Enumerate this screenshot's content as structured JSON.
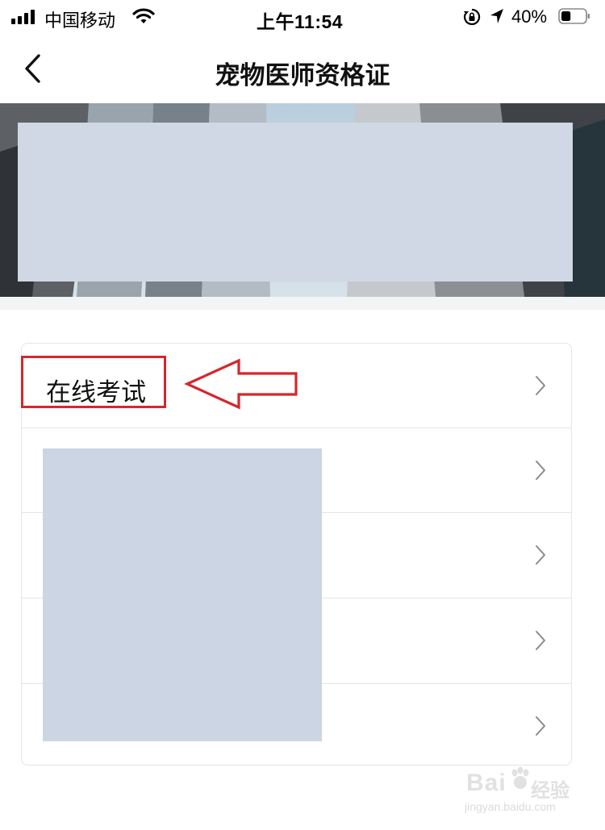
{
  "status_bar": {
    "carrier": "中国移动",
    "time": "上午11:54",
    "battery_percent": "40%",
    "battery_level": 0.4,
    "icons": [
      "signal-icon",
      "wifi-icon",
      "rotation-lock-icon",
      "location-arrow-icon",
      "battery-icon"
    ]
  },
  "nav": {
    "title": "宠物医师资格证",
    "back_icon": "chevron-left-icon"
  },
  "menu": {
    "items": [
      {
        "label": "在线考试",
        "chevron_icon": "chevron-right-icon"
      },
      {
        "label": "",
        "chevron_icon": "chevron-right-icon"
      },
      {
        "label": "",
        "chevron_icon": "chevron-right-icon"
      },
      {
        "label": "",
        "chevron_icon": "chevron-right-icon"
      },
      {
        "label": "",
        "chevron_icon": "chevron-right-icon"
      }
    ]
  },
  "watermark": {
    "brand": "Bai",
    "suffix": "经验",
    "url": "jingyan.baidu.com"
  },
  "colors": {
    "annotation": "#d6262c",
    "redaction": "#cfd8e4",
    "divider": "#e4e5e7"
  }
}
